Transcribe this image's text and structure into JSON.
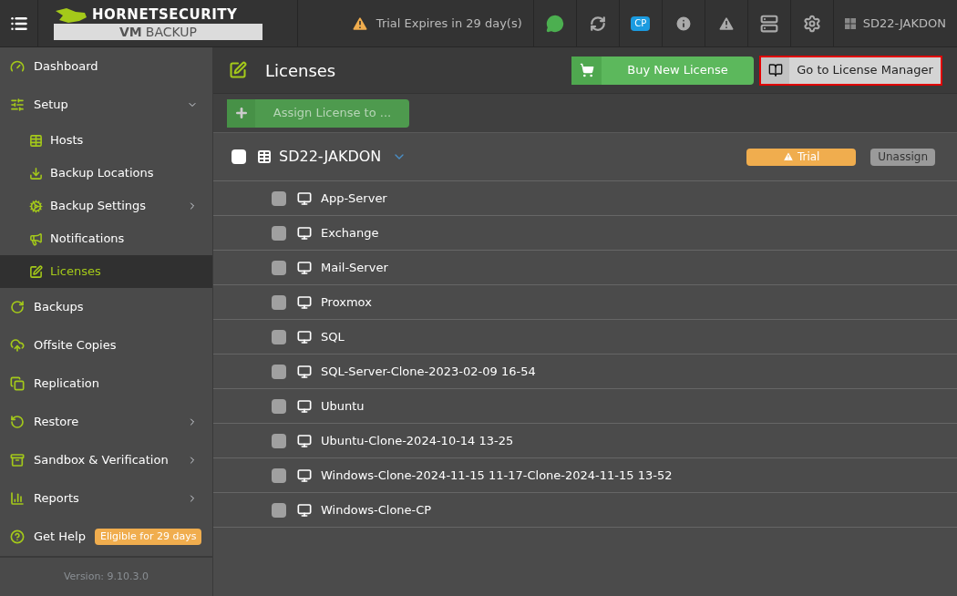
{
  "header": {
    "logo_brand": "HORNETSECURITY",
    "logo_product_bold": "VM",
    "logo_product": "BACKUP",
    "trial_notice": "Trial Expires in 29 day(s)",
    "cp_badge": "CP",
    "host_name": "SD22-JAKDON"
  },
  "sidebar": {
    "items": [
      {
        "label": "Dashboard",
        "selected": false
      },
      {
        "label": "Setup",
        "selected": false,
        "expanded": true,
        "children": [
          {
            "label": "Hosts",
            "selected": false
          },
          {
            "label": "Backup Locations",
            "selected": false
          },
          {
            "label": "Backup Settings",
            "selected": false,
            "expanded": false
          },
          {
            "label": "Notifications",
            "selected": false
          },
          {
            "label": "Licenses",
            "selected": true
          }
        ]
      },
      {
        "label": "Backups",
        "selected": false
      },
      {
        "label": "Offsite Copies",
        "selected": false
      },
      {
        "label": "Replication",
        "selected": false
      },
      {
        "label": "Restore",
        "selected": false,
        "expanded": false
      },
      {
        "label": "Sandbox & Verification",
        "selected": false,
        "expanded": false
      },
      {
        "label": "Reports",
        "selected": false,
        "expanded": false
      },
      {
        "label": "Get Help",
        "selected": false,
        "badge": "Eligible for 29 days"
      }
    ],
    "version": "Version: 9.10.3.0"
  },
  "page": {
    "title": "Licenses",
    "buttons": [
      "Buy New License",
      "Go to License Manager"
    ],
    "assign_button": {
      "label": "Assign License to ...",
      "disabled": true
    },
    "host": {
      "name": "SD22-JAKDON",
      "checked": false,
      "expanded": true,
      "license_badge": "Trial",
      "unassign_button": "Unassign"
    },
    "vms": [
      {
        "name": "App-Server",
        "checked": false
      },
      {
        "name": "Exchange",
        "checked": false
      },
      {
        "name": "Mail-Server",
        "checked": false
      },
      {
        "name": "Proxmox",
        "checked": false
      },
      {
        "name": "SQL",
        "checked": false
      },
      {
        "name": "SQL-Server-Clone-2023-02-09 16-54",
        "checked": false
      },
      {
        "name": "Ubuntu",
        "checked": false
      },
      {
        "name": "Ubuntu-Clone-2024-10-14 13-25",
        "checked": false
      },
      {
        "name": "Windows-Clone-2024-11-15 11-17-Clone-2024-11-15 13-52",
        "checked": false
      },
      {
        "name": "Windows-Clone-CP",
        "checked": false
      }
    ]
  }
}
